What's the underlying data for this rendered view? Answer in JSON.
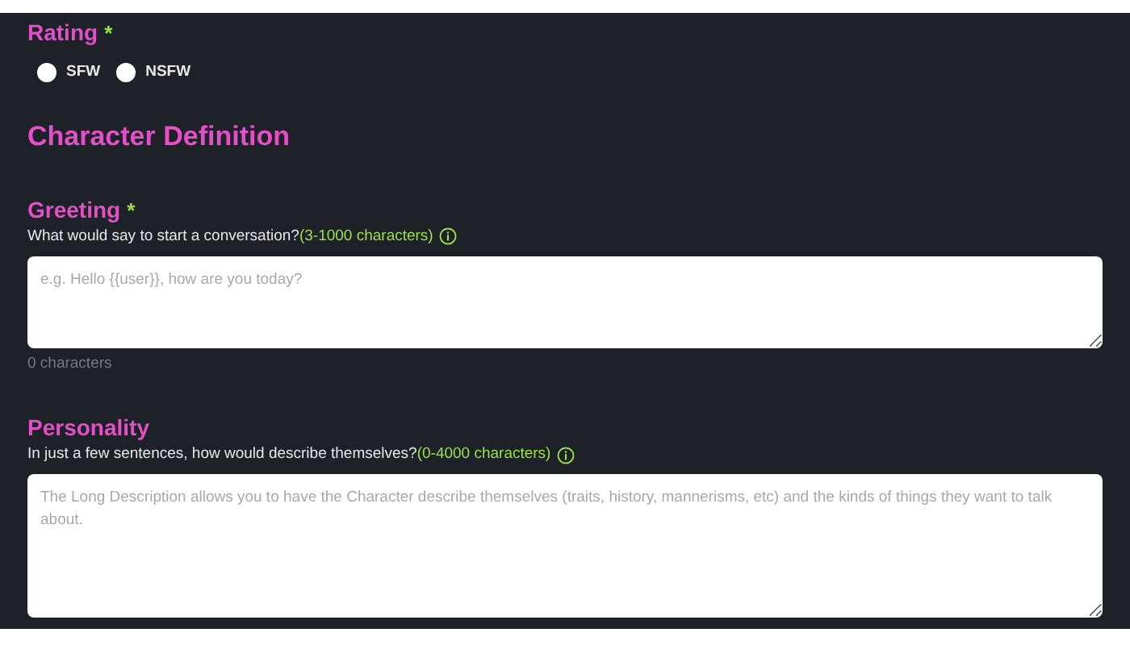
{
  "rating": {
    "label": "Rating",
    "required_mark": "*",
    "options": [
      {
        "label": "SFW",
        "selected": false
      },
      {
        "label": "NSFW",
        "selected": false
      }
    ]
  },
  "section_title": "Character Definition",
  "fields": [
    {
      "label": "Greeting",
      "required_mark": "*",
      "description": "What would say to start a conversation?",
      "limit": "(3-1000 characters)",
      "placeholder": "e.g. Hello {{user}}, how are you today?",
      "counter": "0 characters"
    },
    {
      "label": "Personality",
      "description": "In just a few sentences, how would describe themselves?",
      "limit": "(0-4000 characters)",
      "placeholder": "The Long Description allows you to have the Character describe themselves (traits, history, mannerisms, etc) and the kinds of things they want to talk about."
    }
  ]
}
